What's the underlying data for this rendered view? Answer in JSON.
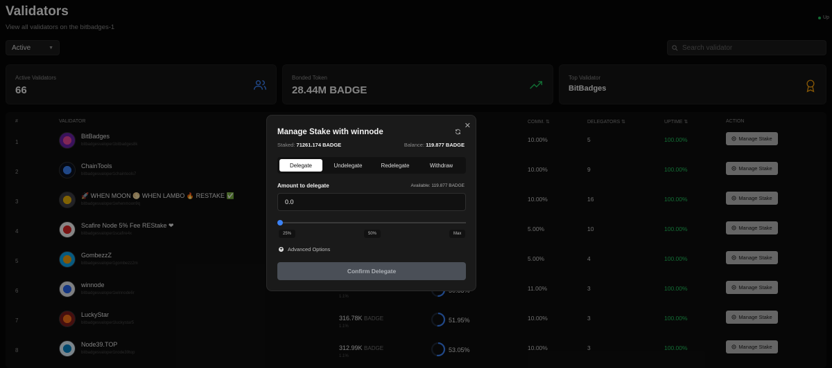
{
  "header": {
    "title": "Validators",
    "subtitle": "View all validators on the bitbadges-1",
    "status": "Up"
  },
  "filter": {
    "selected": "Active"
  },
  "search": {
    "placeholder": "Search validator"
  },
  "stats": [
    {
      "label": "Active Validators",
      "value": "66",
      "icon": "users-icon"
    },
    {
      "label": "Bonded Token",
      "value": "28.44M BADGE",
      "icon": "trending-up-icon"
    },
    {
      "label": "Top Validator",
      "value": "BitBadges",
      "icon": "award-icon"
    }
  ],
  "table": {
    "columns": {
      "num": "#",
      "validator": "Validator",
      "comm": "Comm. ⇅",
      "delegators": "Delegators ⇅",
      "uptime": "Uptime ⇅",
      "action": "Action"
    },
    "rows": [
      {
        "num": "1",
        "name": "BitBadges",
        "addr": "bitbadgesvaloper1bitbadges8k",
        "comm": "10.00%",
        "delegators": "5",
        "uptime": "100.00%",
        "action": "Manage Stake"
      },
      {
        "num": "2",
        "name": "ChainTools",
        "addr": "bitbadgesvaloper1chaintools7",
        "comm": "10.00%",
        "delegators": "9",
        "uptime": "100.00%",
        "action": "Manage Stake"
      },
      {
        "num": "3",
        "name": "🚀 WHEN MOON 🌕 WHEN LAMBO 🔥 RESTAKE ✅",
        "addr": "bitbadgesvaloper1whenmoon9q",
        "comm": "10.00%",
        "delegators": "16",
        "uptime": "100.00%",
        "action": "Manage Stake"
      },
      {
        "num": "4",
        "name": "Scafire Node 5% Fee REStake ❤",
        "addr": "bitbadgesvaloper1scafire4x",
        "comm": "5.00%",
        "delegators": "10",
        "uptime": "100.00%",
        "action": "Manage Stake"
      },
      {
        "num": "5",
        "name": "GombezzZ",
        "addr": "bitbadgesvaloper1gombezz2m",
        "comm": "5.00%",
        "delegators": "4",
        "uptime": "100.00%",
        "action": "Manage Stake"
      },
      {
        "num": "6",
        "name": "winnode",
        "addr": "bitbadgesvaloper1winnode6r",
        "bonded_pct": "1.1%",
        "cumulative": "50.83%",
        "cumulative_value": 0.5083,
        "comm": "11.00%",
        "delegators": "3",
        "uptime": "100.00%",
        "action": "Manage Stake"
      },
      {
        "num": "7",
        "name": "LuckyStar",
        "addr": "bitbadgesvaloper1luckystar5",
        "bonded": "316.78K",
        "bonded_unit": "BADGE",
        "bonded_pct": "1.1%",
        "cumulative": "51.95%",
        "cumulative_value": 0.5195,
        "comm": "10.00%",
        "delegators": "3",
        "uptime": "100.00%",
        "action": "Manage Stake"
      },
      {
        "num": "8",
        "name": "Node39.TOP",
        "addr": "bitbadgesvaloper1node39top",
        "bonded": "312.99K",
        "bonded_unit": "BADGE",
        "bonded_pct": "1.1%",
        "cumulative": "53.05%",
        "cumulative_value": 0.5305,
        "comm": "10.00%",
        "delegators": "3",
        "uptime": "100.00%",
        "action": "Manage Stake"
      }
    ]
  },
  "modal": {
    "title": "Manage Stake with winnode",
    "staked_label": "Staked:",
    "staked_value": "71261.174 BADGE",
    "balance_label": "Balance:",
    "balance_value": "119.877 BADGE",
    "tabs": [
      "Delegate",
      "Undelegate",
      "Redelegate",
      "Withdraw"
    ],
    "active_tab": "Delegate",
    "amount_label": "Amount to delegate",
    "available": "Available: 119.877 BADGE",
    "amount_value": "0.0",
    "slider_value": 0,
    "presets": [
      "25%",
      "50%",
      "Max"
    ],
    "advanced": "Advanced Options",
    "confirm": "Confirm Delegate"
  },
  "colors": {
    "accent": "#3b82f6",
    "success": "#22c55e",
    "trend": "#22c55e",
    "award": "#f59e0b"
  }
}
